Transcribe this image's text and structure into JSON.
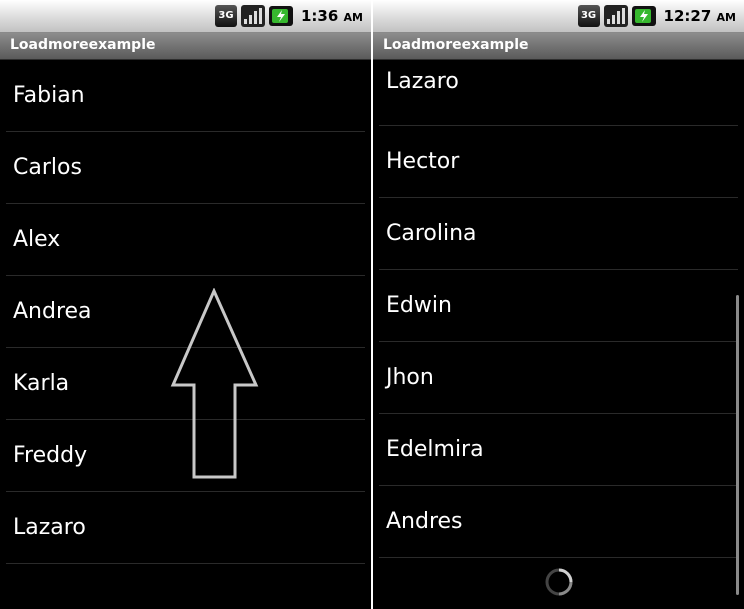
{
  "screens": [
    {
      "status": {
        "network": "3G",
        "time": "1:36",
        "ampm": "AM"
      },
      "app_title": "Loadmoreexample",
      "items": [
        "Fabian",
        "Carlos",
        "Alex",
        "Andrea",
        "Karla",
        "Freddy",
        "Lazaro"
      ],
      "gesture_icon": "swipe-up-arrow-icon"
    },
    {
      "status": {
        "network": "3G",
        "time": "12:27",
        "ampm": "AM"
      },
      "app_title": "Loadmoreexample",
      "items": [
        "Lazaro",
        "Hector",
        "Carolina",
        "Edwin",
        "Jhon",
        "Edelmira",
        "Andres"
      ],
      "footer_icon": "loading-spinner-icon"
    }
  ],
  "colors": {
    "background": "#000000",
    "text": "#ffffff",
    "divider": "#2a2a2a",
    "titlebar": "#6e6e6e",
    "battery": "#36b82e"
  }
}
